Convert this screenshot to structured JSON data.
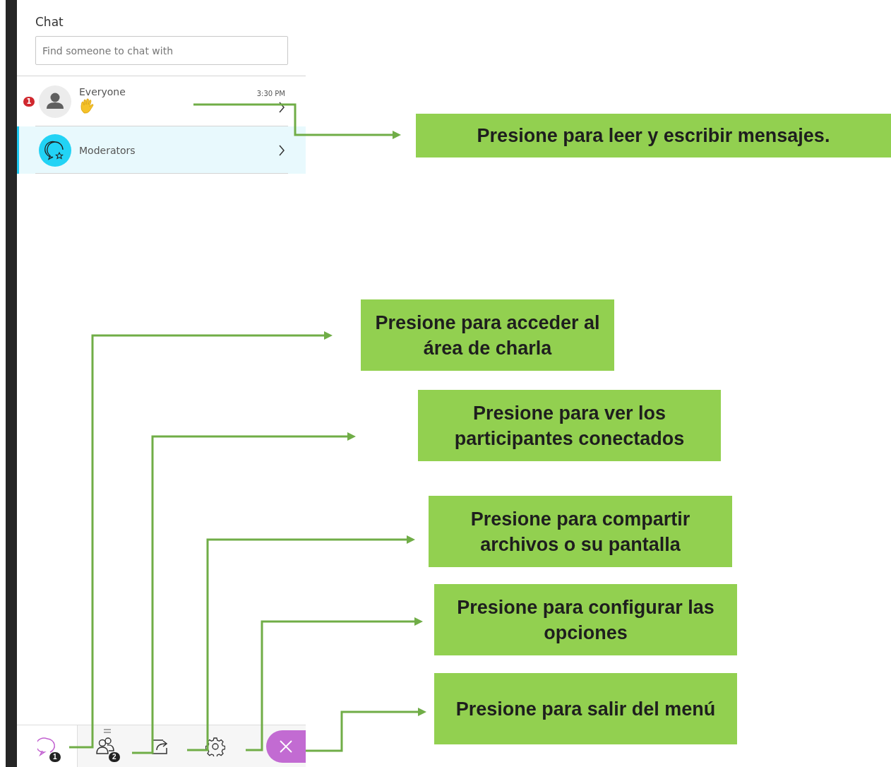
{
  "chat": {
    "title": "Chat",
    "search": {
      "placeholder": "Find someone to chat with"
    },
    "conversations": [
      {
        "kind": "everyone",
        "name": "Everyone",
        "unread": "1",
        "time": "3:30 PM",
        "selected": false
      },
      {
        "kind": "moderators",
        "name": "Moderators",
        "selected": true
      }
    ]
  },
  "toolbar": {
    "tabs": [
      {
        "kind": "chat",
        "badge": "1",
        "selected": true
      },
      {
        "kind": "participants",
        "badge": "2",
        "selected": false
      },
      {
        "kind": "share",
        "selected": false
      },
      {
        "kind": "settings",
        "selected": false
      }
    ]
  },
  "callouts": [
    {
      "text": "Presione para leer y escribir mensajes."
    },
    {
      "text": "Presione para acceder al área de charla"
    },
    {
      "text": "Presione para ver los participantes conectados"
    },
    {
      "text": "Presione para compartir archivos o su pantalla"
    },
    {
      "text": "Presione para configurar las opciones"
    },
    {
      "text": "Presione para salir del menú"
    }
  ]
}
